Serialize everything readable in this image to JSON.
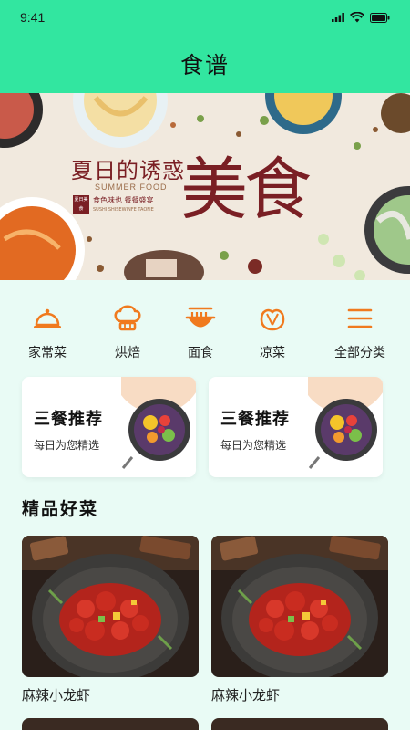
{
  "status_bar": {
    "time": "9:41"
  },
  "header": {
    "title": "食谱"
  },
  "banner": {
    "headline": "夏日的诱惑",
    "subtitle_en": "SUMMER FOOD",
    "big_text": "美食",
    "seal_text": "夏日美食",
    "tagline": "食色味也  餐餐盛宴",
    "tagline_en": "SUSHI SHISEWINFE TAOFIE"
  },
  "categories": [
    {
      "label": "家常菜",
      "icon": "cloche-icon"
    },
    {
      "label": "烘焙",
      "icon": "chef-hat-icon"
    },
    {
      "label": "面食",
      "icon": "noodle-bowl-icon"
    },
    {
      "label": "凉菜",
      "icon": "vegetable-icon"
    },
    {
      "label": "全部分类",
      "icon": "menu-icon"
    }
  ],
  "promos": [
    {
      "title": "三餐推荐",
      "subtitle": "每日为您精选"
    },
    {
      "title": "三餐推荐",
      "subtitle": "每日为您精选"
    }
  ],
  "section": {
    "title": "精品好菜"
  },
  "dishes": [
    {
      "name": "麻辣小龙虾"
    },
    {
      "name": "麻辣小龙虾"
    }
  ],
  "colors": {
    "accent": "#32e6a0",
    "icon": "#f07a1e",
    "page_bg": "#e9fbf5",
    "banner_red": "#7a1f24"
  }
}
